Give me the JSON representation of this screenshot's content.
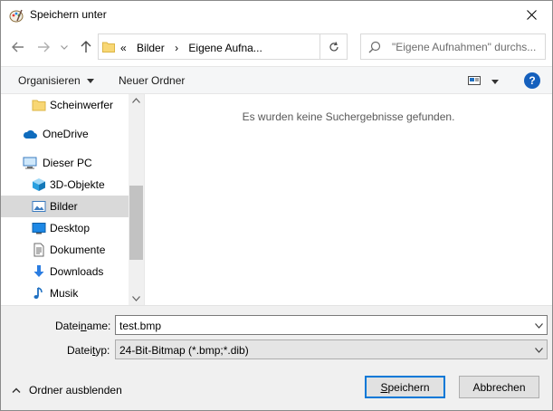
{
  "window": {
    "title": "Speichern unter"
  },
  "address": {
    "overflow": "«",
    "crumbs": [
      "Bilder",
      "›",
      "Eigene Aufna..."
    ]
  },
  "search": {
    "placeholder": "\"Eigene Aufnahmen\" durchs..."
  },
  "toolbar": {
    "organize": "Organisieren",
    "new_folder": "Neuer Ordner",
    "help": "?"
  },
  "nav": {
    "items": [
      {
        "label": "Scheinwerfer",
        "icon": "folder-icon"
      },
      {
        "label": "OneDrive",
        "icon": "cloud-icon"
      },
      {
        "label": "Dieser PC",
        "icon": "computer-icon"
      },
      {
        "label": "3D-Objekte",
        "icon": "cube-icon"
      },
      {
        "label": "Bilder",
        "icon": "pictures-icon",
        "selected": true
      },
      {
        "label": "Desktop",
        "icon": "desktop-icon"
      },
      {
        "label": "Dokumente",
        "icon": "document-icon"
      },
      {
        "label": "Downloads",
        "icon": "download-icon"
      },
      {
        "label": "Musik",
        "icon": "music-icon"
      }
    ]
  },
  "content": {
    "empty_message": "Es wurden keine Suchergebnisse gefunden."
  },
  "form": {
    "filename_label_pre": "Datei",
    "filename_label_ul": "n",
    "filename_label_post": "ame:",
    "filename_value": "test.bmp",
    "filetype_label_pre": "Datei",
    "filetype_label_ul": "t",
    "filetype_label_post": "yp:",
    "filetype_value": "24-Bit-Bitmap (*.bmp;*.dib)"
  },
  "footer": {
    "hide_folders": "Ordner ausblenden",
    "save_pre": "",
    "save_ul": "S",
    "save_post": "peichern",
    "cancel": "Abbrechen"
  },
  "colors": {
    "accent": "#0078d7",
    "selected_bg": "#d9d9d9",
    "help_blue": "#1560bd"
  }
}
